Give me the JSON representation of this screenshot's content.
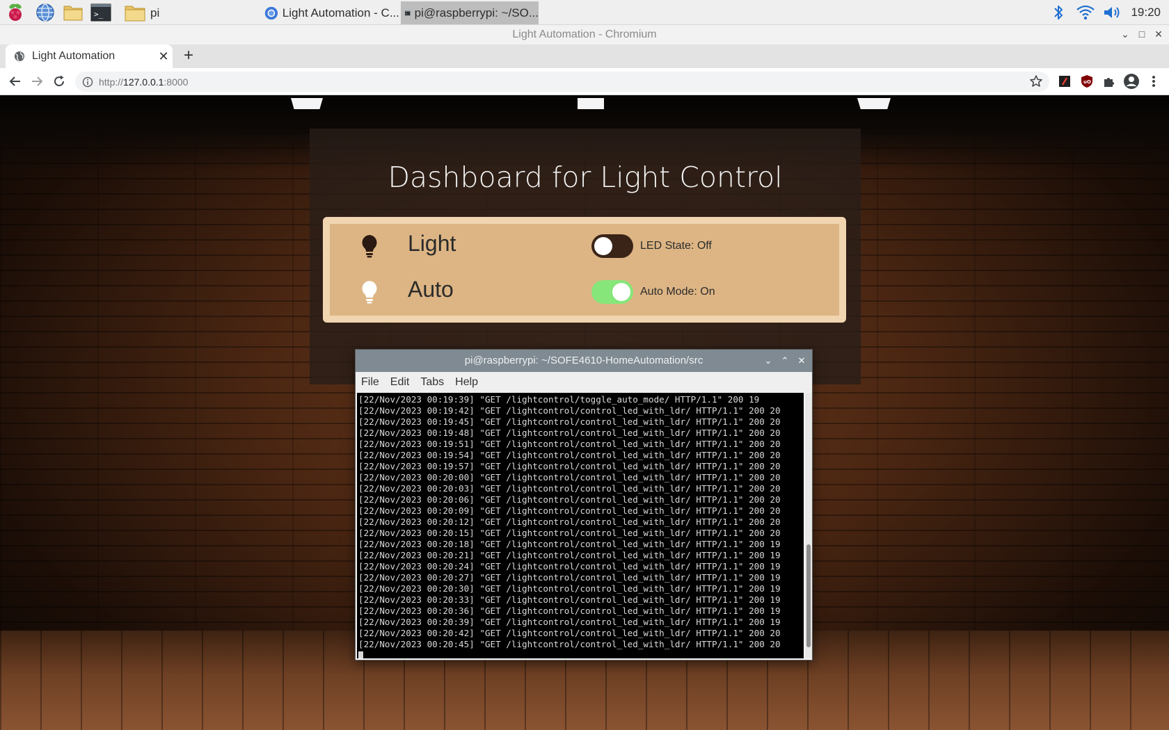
{
  "taskbar": {
    "launchers": [
      "raspberry-menu",
      "web-browser",
      "file-manager",
      "terminal"
    ],
    "tasks": [
      {
        "label": "pi",
        "icon": "folder-icon"
      },
      {
        "label": "Light Automation - C...",
        "icon": "chromium-icon"
      },
      {
        "label": "pi@raspberrypi: ~/SO...",
        "icon": "terminal-icon"
      }
    ],
    "clock": "19:20"
  },
  "browser": {
    "window_title": "Light Automation - Chromium",
    "tab_title": "Light Automation",
    "url_prefix": "http://",
    "url_host": "127.0.0.1",
    "url_suffix": ":8000"
  },
  "dashboard": {
    "title": "Dashboard for Light Control",
    "rows": [
      {
        "label": "Light",
        "state": "LED State: Off",
        "toggle_on": false
      },
      {
        "label": "Auto",
        "state": "Auto Mode: On",
        "toggle_on": true
      }
    ]
  },
  "terminal": {
    "title": "pi@raspberrypi: ~/SOFE4610-HomeAutomation/src",
    "menu": [
      "File",
      "Edit",
      "Tabs",
      "Help"
    ],
    "log": [
      "[22/Nov/2023 00:19:39] \"GET /lightcontrol/toggle_auto_mode/ HTTP/1.1\" 200 19",
      "[22/Nov/2023 00:19:42] \"GET /lightcontrol/control_led_with_ldr/ HTTP/1.1\" 200 20",
      "[22/Nov/2023 00:19:45] \"GET /lightcontrol/control_led_with_ldr/ HTTP/1.1\" 200 20",
      "[22/Nov/2023 00:19:48] \"GET /lightcontrol/control_led_with_ldr/ HTTP/1.1\" 200 20",
      "[22/Nov/2023 00:19:51] \"GET /lightcontrol/control_led_with_ldr/ HTTP/1.1\" 200 20",
      "[22/Nov/2023 00:19:54] \"GET /lightcontrol/control_led_with_ldr/ HTTP/1.1\" 200 20",
      "[22/Nov/2023 00:19:57] \"GET /lightcontrol/control_led_with_ldr/ HTTP/1.1\" 200 20",
      "[22/Nov/2023 00:20:00] \"GET /lightcontrol/control_led_with_ldr/ HTTP/1.1\" 200 20",
      "[22/Nov/2023 00:20:03] \"GET /lightcontrol/control_led_with_ldr/ HTTP/1.1\" 200 20",
      "[22/Nov/2023 00:20:06] \"GET /lightcontrol/control_led_with_ldr/ HTTP/1.1\" 200 20",
      "[22/Nov/2023 00:20:09] \"GET /lightcontrol/control_led_with_ldr/ HTTP/1.1\" 200 20",
      "[22/Nov/2023 00:20:12] \"GET /lightcontrol/control_led_with_ldr/ HTTP/1.1\" 200 20",
      "[22/Nov/2023 00:20:15] \"GET /lightcontrol/control_led_with_ldr/ HTTP/1.1\" 200 20",
      "[22/Nov/2023 00:20:18] \"GET /lightcontrol/control_led_with_ldr/ HTTP/1.1\" 200 19",
      "[22/Nov/2023 00:20:21] \"GET /lightcontrol/control_led_with_ldr/ HTTP/1.1\" 200 19",
      "[22/Nov/2023 00:20:24] \"GET /lightcontrol/control_led_with_ldr/ HTTP/1.1\" 200 19",
      "[22/Nov/2023 00:20:27] \"GET /lightcontrol/control_led_with_ldr/ HTTP/1.1\" 200 19",
      "[22/Nov/2023 00:20:30] \"GET /lightcontrol/control_led_with_ldr/ HTTP/1.1\" 200 19",
      "[22/Nov/2023 00:20:33] \"GET /lightcontrol/control_led_with_ldr/ HTTP/1.1\" 200 19",
      "[22/Nov/2023 00:20:36] \"GET /lightcontrol/control_led_with_ldr/ HTTP/1.1\" 200 19",
      "[22/Nov/2023 00:20:39] \"GET /lightcontrol/control_led_with_ldr/ HTTP/1.1\" 200 19",
      "[22/Nov/2023 00:20:42] \"GET /lightcontrol/control_led_with_ldr/ HTTP/1.1\" 200 20",
      "[22/Nov/2023 00:20:45] \"GET /lightcontrol/control_led_with_ldr/ HTTP/1.1\" 200 20"
    ]
  },
  "colors": {
    "card_bg": "#ddb584",
    "toggle_off": "#3a2418",
    "toggle_on": "#86e67a",
    "terminal_titlebar": "#7f8a92"
  }
}
